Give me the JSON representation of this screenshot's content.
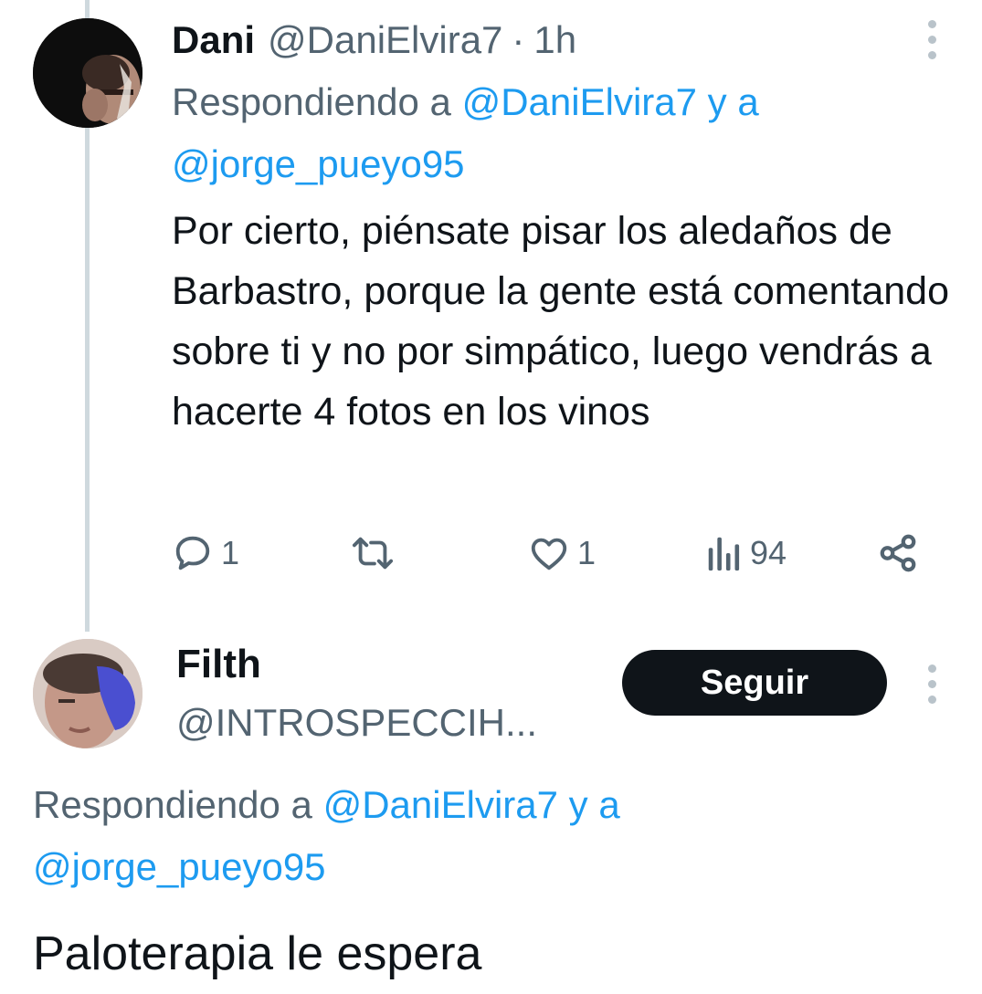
{
  "tweets": [
    {
      "name": "Dani",
      "handle": "@DaniElvira7",
      "separator": "·",
      "time": "1h",
      "reply_prefix": "Respondiendo a",
      "reply_mention_1": "@DaniElvira7",
      "reply_join": "y a",
      "reply_mention_2": "@jorge_pueyo95",
      "text": "Por cierto, piénsate pisar los aledaños de Barbastro, porque la gente está comentando sobre ti y no por simpático, luego vendrás a hacerte 4 fotos en los vinos",
      "actions": {
        "replies": "1",
        "retweets": "",
        "likes": "1",
        "views": "94"
      }
    },
    {
      "name": "Filth",
      "handle": "@INTROSPECCIH...",
      "follow_label": "Seguir",
      "reply_prefix": "Respondiendo a",
      "reply_mention_1": "@DaniElvira7",
      "reply_join": "y a",
      "reply_mention_2": "@jorge_pueyo95",
      "text": "Paloterapia le espera"
    }
  ],
  "icons": {
    "more": "more-vertical-icon",
    "reply": "reply-icon",
    "retweet": "retweet-icon",
    "like": "heart-icon",
    "views": "views-icon",
    "share": "share-icon"
  },
  "colors": {
    "text": "#0f1419",
    "secondary": "#536471",
    "link": "#1d9bf0",
    "thread_line": "#cfd9de",
    "button_bg": "#0f1419",
    "button_text": "#ffffff"
  }
}
